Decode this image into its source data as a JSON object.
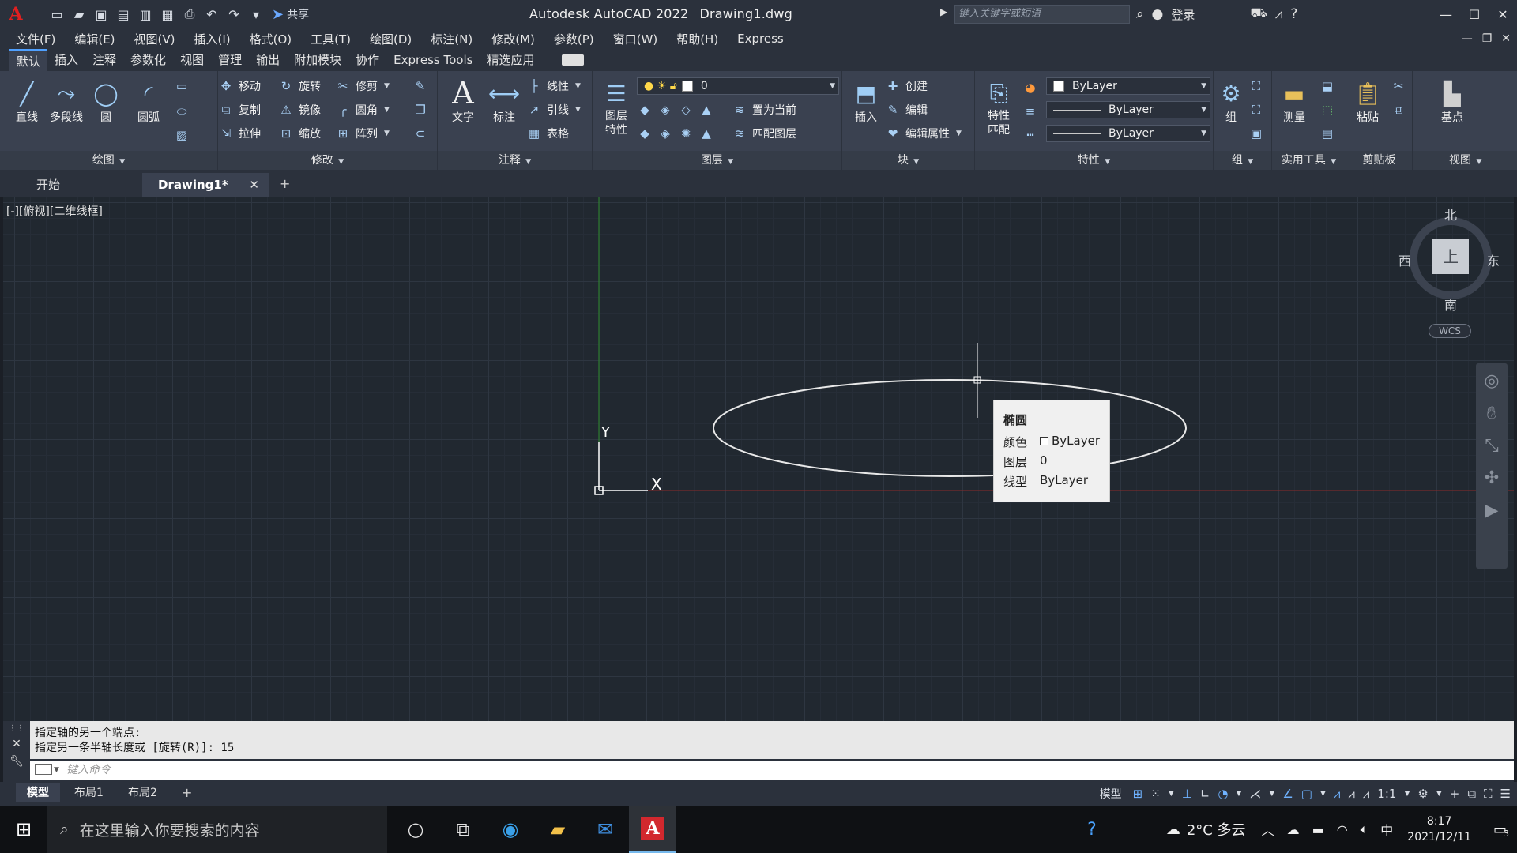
{
  "titlebar": {
    "app_name": "Autodesk AutoCAD 2022",
    "file_name": "Drawing1.dwg",
    "share_label": "共享",
    "search_placeholder": "键入关键字或短语",
    "login_label": "登录"
  },
  "menubar": {
    "items": [
      "文件(F)",
      "编辑(E)",
      "视图(V)",
      "插入(I)",
      "格式(O)",
      "工具(T)",
      "绘图(D)",
      "标注(N)",
      "修改(M)",
      "参数(P)",
      "窗口(W)",
      "帮助(H)",
      "Express"
    ]
  },
  "ribbon_tabs": [
    "默认",
    "插入",
    "注释",
    "参数化",
    "视图",
    "管理",
    "输出",
    "附加模块",
    "协作",
    "Express Tools",
    "精选应用"
  ],
  "ribbon": {
    "draw": {
      "title": "绘图",
      "line": "直线",
      "polyline": "多段线",
      "circle": "圆",
      "arc": "圆弧"
    },
    "modify": {
      "title": "修改",
      "move": "移动",
      "rotate": "旋转",
      "trim": "修剪",
      "copy": "复制",
      "mirror": "镜像",
      "fillet": "圆角",
      "stretch": "拉伸",
      "scale": "缩放",
      "array": "阵列"
    },
    "annotation": {
      "title": "注释",
      "text": "文字",
      "dimension": "标注",
      "linear": "线性",
      "leader": "引线",
      "table": "表格"
    },
    "layers": {
      "title": "图层",
      "layer_props": "图层\n特性",
      "current_layer": "0",
      "set_current": "置为当前",
      "match_layer": "匹配图层"
    },
    "block": {
      "title": "块",
      "insert": "插入",
      "create": "创建",
      "edit": "编辑",
      "edit_attr": "编辑属性"
    },
    "properties": {
      "title": "特性",
      "match": "特性\n匹配",
      "color": "ByLayer",
      "lineweight": "ByLayer",
      "linetype": "ByLayer"
    },
    "groups": {
      "title": "组",
      "group": "组"
    },
    "utilities": {
      "title": "实用工具",
      "measure": "测量"
    },
    "clipboard": {
      "title": "剪贴板",
      "paste": "粘贴"
    },
    "view": {
      "title": "视图",
      "base": "基点"
    }
  },
  "doc_tabs": {
    "start": "开始",
    "drawing": "Drawing1*"
  },
  "viewport": {
    "label": "[-][俯视][二维线框]",
    "ucs_x": "X",
    "ucs_y": "Y"
  },
  "viewcube": {
    "north": "北",
    "south": "南",
    "east": "东",
    "west": "西",
    "face": "上",
    "wcs": "WCS"
  },
  "tooltip": {
    "title": "椭圆",
    "color_key": "颜色",
    "color_val": "ByLayer",
    "layer_key": "图层",
    "layer_val": "0",
    "linetype_key": "线型",
    "linetype_val": "ByLayer"
  },
  "command": {
    "line1": "指定轴的另一个端点:",
    "line2": "指定另一条半轴长度或 [旋转(R)]: 15",
    "input_placeholder": "键入命令"
  },
  "layout_tabs": [
    "模型",
    "布局1",
    "布局2"
  ],
  "statusbar": {
    "model_label": "模型",
    "scale": "1:1"
  },
  "taskbar": {
    "search_placeholder": "在这里输入你要搜索的内容",
    "weather": "2°C 多云",
    "ime": "中",
    "time": "8:17",
    "date": "2021/12/11",
    "notif_count": "3"
  },
  "colors": {
    "accent": "#4fa0ff",
    "canvas_bg": "#212830",
    "ribbon_bg": "#3a4150",
    "titlebar_bg": "#2b313c",
    "ellipse": "#e8e8e8",
    "y_axis": "#2e8b2e",
    "x_axis": "#8b2a2a"
  }
}
